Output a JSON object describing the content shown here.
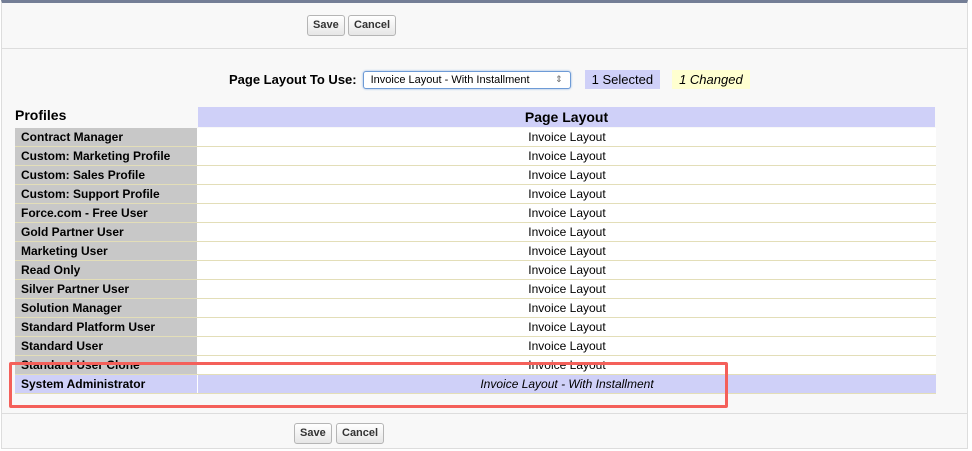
{
  "buttons": {
    "save": "Save",
    "cancel": "Cancel"
  },
  "chooser": {
    "label": "Page Layout To Use:",
    "selected": "Invoice Layout - With Installment",
    "arrow": "⇕",
    "selected_count": "1 Selected",
    "changed_count": "1 Changed"
  },
  "table": {
    "profiles_header": "Profiles",
    "layout_header": "Page Layout",
    "rows": [
      {
        "profile": "Contract Manager",
        "layout": "Invoice Layout"
      },
      {
        "profile": "Custom: Marketing Profile",
        "layout": "Invoice Layout"
      },
      {
        "profile": "Custom: Sales Profile",
        "layout": "Invoice Layout"
      },
      {
        "profile": "Custom: Support Profile",
        "layout": "Invoice Layout"
      },
      {
        "profile": "Force.com - Free User",
        "layout": "Invoice Layout"
      },
      {
        "profile": "Gold Partner User",
        "layout": "Invoice Layout"
      },
      {
        "profile": "Marketing User",
        "layout": "Invoice Layout"
      },
      {
        "profile": "Read Only",
        "layout": "Invoice Layout"
      },
      {
        "profile": "Silver Partner User",
        "layout": "Invoice Layout"
      },
      {
        "profile": "Solution Manager",
        "layout": "Invoice Layout"
      },
      {
        "profile": "Standard Platform User",
        "layout": "Invoice Layout"
      },
      {
        "profile": "Standard User",
        "layout": "Invoice Layout"
      },
      {
        "profile": "Standard User Clone",
        "layout": "Invoice Layout"
      },
      {
        "profile": "System Administrator",
        "layout": "Invoice Layout - With Installment"
      }
    ]
  }
}
